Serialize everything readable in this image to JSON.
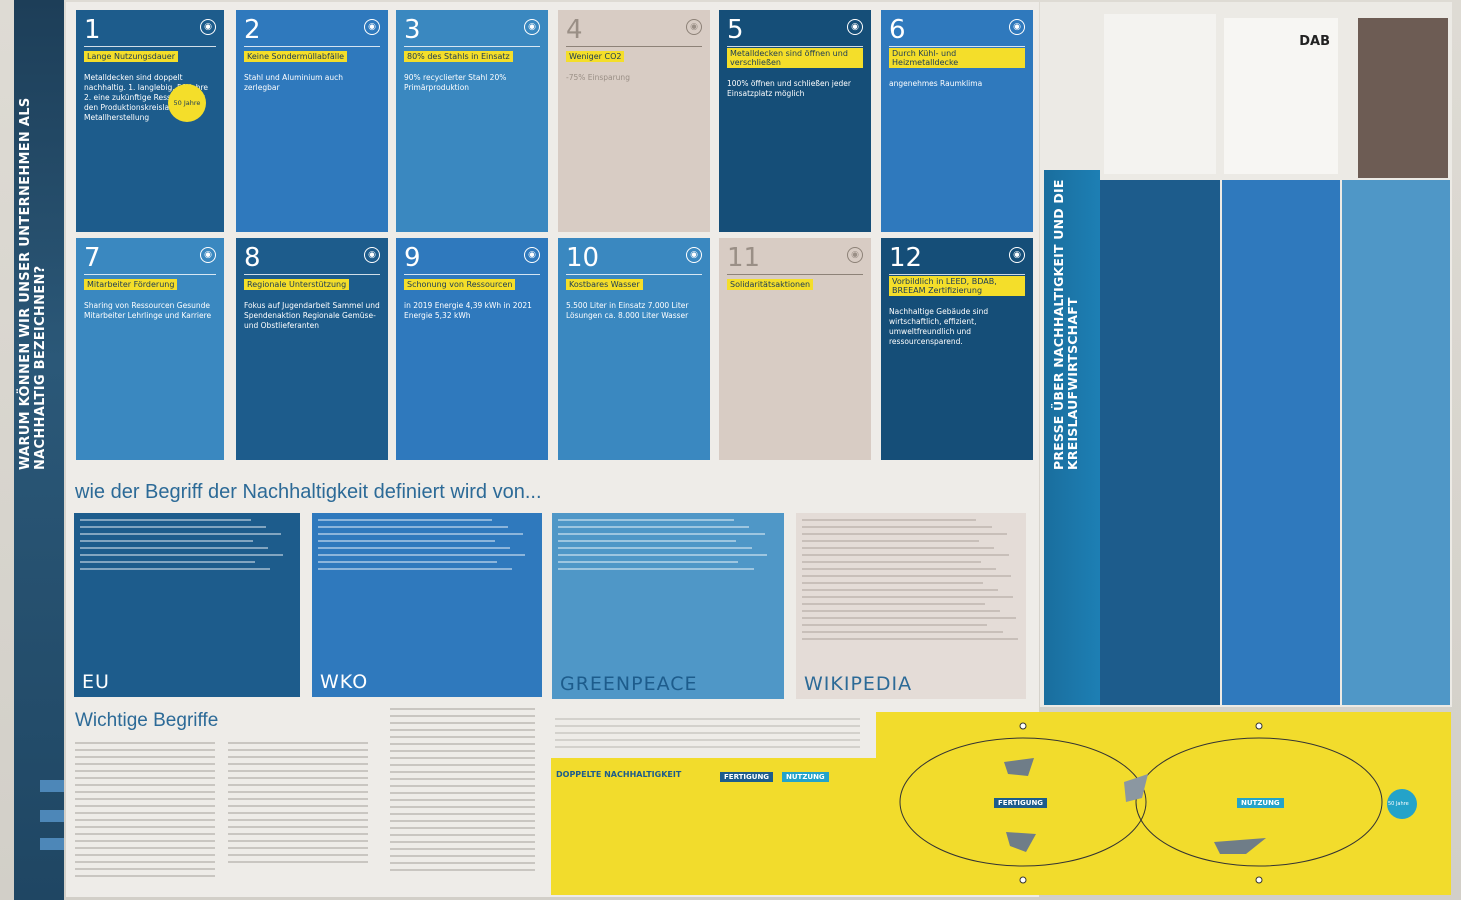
{
  "banner": {
    "text": "WARUM KÖNNEN WIR UNSER UNTERNEHMEN ALS NACHHALTIG BEZEICHNEN?"
  },
  "cards": [
    {
      "num": "1",
      "headline": "Lange Nutzungsdauer",
      "badge": "50 Jahre",
      "body": "Metalldecken sind doppelt nachhaltig. 1. langlebig, 50 Jahre 2. eine zukünftige Ressource für den Produktionskreislauf der Metallherstellung",
      "color": "#1d5c8c"
    },
    {
      "num": "2",
      "headline": "Keine Sondermüllabfälle",
      "body": "Stahl und Aluminium auch zerlegbar",
      "color": "#2f79bd"
    },
    {
      "num": "3",
      "headline": "80% des Stahls in Einsatz",
      "body": "90% recyclierter Stahl 20% Primärproduktion",
      "color": "#3a88c0"
    },
    {
      "num": "4",
      "headline": "Weniger CO2",
      "body": "-75% Einsparung",
      "color": "#d8ccc4",
      "light": true
    },
    {
      "num": "5",
      "headline": "Metalldecken sind öffnen und verschließen",
      "body": "100% öffnen und schließen jeder Einsatzplatz möglich",
      "color": "#154e78"
    },
    {
      "num": "6",
      "headline": "Durch Kühl- und Heizmetalldecke",
      "body": "angenehmes Raumklima",
      "color": "#2f79bd"
    },
    {
      "num": "7",
      "headline": "Mitarbeiter Förderung",
      "body": "Sharing von Ressourcen Gesunde Mitarbeiter Lehrlinge und Karriere",
      "color": "#3a88c0"
    },
    {
      "num": "8",
      "headline": "Regionale Unterstützung",
      "body": "Fokus auf Jugendarbeit Sammel und Spendenaktion Regionale Gemüse- und Obstlieferanten",
      "color": "#1d5c8c"
    },
    {
      "num": "9",
      "headline": "Schonung von Ressourcen",
      "body": "in 2019 Energie 4,39 kWh in 2021 Energie 5,32 kWh",
      "color": "#2f79bd"
    },
    {
      "num": "10",
      "headline": "Kostbares Wasser",
      "body": "5.500 Liter in Einsatz 7.000 Liter Lösungen ca. 8.000 Liter Wasser",
      "color": "#3a88c0"
    },
    {
      "num": "11",
      "headline": "Solidaritätsaktionen",
      "body": "",
      "color": "#d8ccc4",
      "light": true
    },
    {
      "num": "12",
      "headline": "Vorbildlich in LEED, BDAB, BREEAM Zertifizierung",
      "body": "Nachhaltige Gebäude sind wirtschaftlich, effizient, umweltfreundlich und ressourcensparend.",
      "color": "#154e78"
    }
  ],
  "definitions": {
    "heading": "wie der Begriff der Nachhaltigkeit definiert wird von...",
    "items": [
      {
        "name": "EU",
        "color": "#1d5c8c"
      },
      {
        "name": "WKO",
        "color": "#2f79bd"
      },
      {
        "name": "GREENPEACE",
        "color": "#4f97c7"
      },
      {
        "name": "WIKIPEDIA",
        "color": "#e4dcd7"
      }
    ]
  },
  "press": {
    "title": "PRESSE ÜBER NACHHALTIGKEIT UND DIE KREISLAUFWIRTSCHAFT",
    "logo": "DAB"
  },
  "glossary": {
    "heading": "Wichtige Begriffe"
  },
  "cycle": {
    "left_label": "FERTIGUNG",
    "right_label": "NUTZUNG",
    "center_badge": "50 Jahre",
    "title": "DOPPELTE NACHHALTIGKEIT"
  }
}
